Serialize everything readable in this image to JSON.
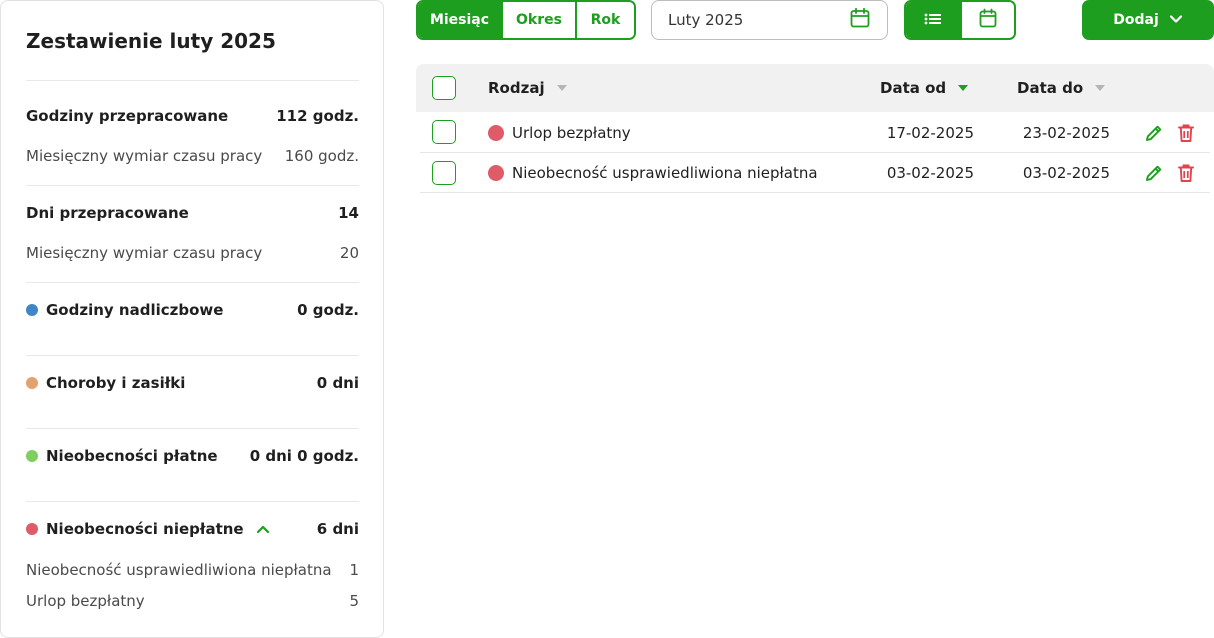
{
  "colors": {
    "accent": "#1e9e1e",
    "danger": "#e0434e",
    "blue": "#3f86c6",
    "orange": "#e4a16e",
    "green": "#7fcf5e",
    "red": "#e05b6a"
  },
  "summary": {
    "title": "Zestawienie luty 2025",
    "hours_worked": {
      "label": "Godziny przepracowane",
      "value": "112 godz."
    },
    "hours_norm": {
      "label": "Miesięczny wymiar czasu pracy",
      "value": "160 godz."
    },
    "days_worked": {
      "label": "Dni przepracowane",
      "value": "14"
    },
    "days_norm": {
      "label": "Miesięczny wymiar czasu pracy",
      "value": "20"
    },
    "overtime": {
      "label": "Godziny nadliczbowe",
      "value": "0 godz.",
      "dot_color": "#3f86c6"
    },
    "sickness": {
      "label": "Choroby i zasiłki",
      "value": "0 dni",
      "dot_color": "#e4a16e"
    },
    "paid_absence": {
      "label": "Nieobecności płatne",
      "value": "0 dni 0 godz.",
      "dot_color": "#7fcf5e"
    },
    "unpaid_absence": {
      "label": "Nieobecności niepłatne",
      "value": "6 dni",
      "dot_color": "#e05b6a",
      "icon": "chevron-up-icon"
    },
    "unpaid_details": [
      {
        "label": "Nieobecność usprawiedliwiona niepłatna",
        "value": "1"
      },
      {
        "label": "Urlop bezpłatny",
        "value": "5"
      }
    ]
  },
  "toolbar": {
    "period_tabs": [
      {
        "label": "Miesiąc",
        "active": true
      },
      {
        "label": "Okres",
        "active": false
      },
      {
        "label": "Rok",
        "active": false
      }
    ],
    "date_value": "Luty 2025",
    "date_icon": "calendar-icon",
    "view_list_icon": "list-icon",
    "view_calendar_icon": "calendar-icon",
    "add_label": "Dodaj",
    "add_icon": "chevron-down-icon"
  },
  "table": {
    "columns": {
      "type": "Rodzaj",
      "date_from": "Data od",
      "date_to": "Data do"
    },
    "rows": [
      {
        "type": "Urlop bezpłatny",
        "date_from": "17-02-2025",
        "date_to": "23-02-2025",
        "dot_color": "#e05b6a"
      },
      {
        "type": "Nieobecność usprawiedliwiona niepłatna",
        "date_from": "03-02-2025",
        "date_to": "03-02-2025",
        "dot_color": "#e05b6a"
      }
    ]
  }
}
